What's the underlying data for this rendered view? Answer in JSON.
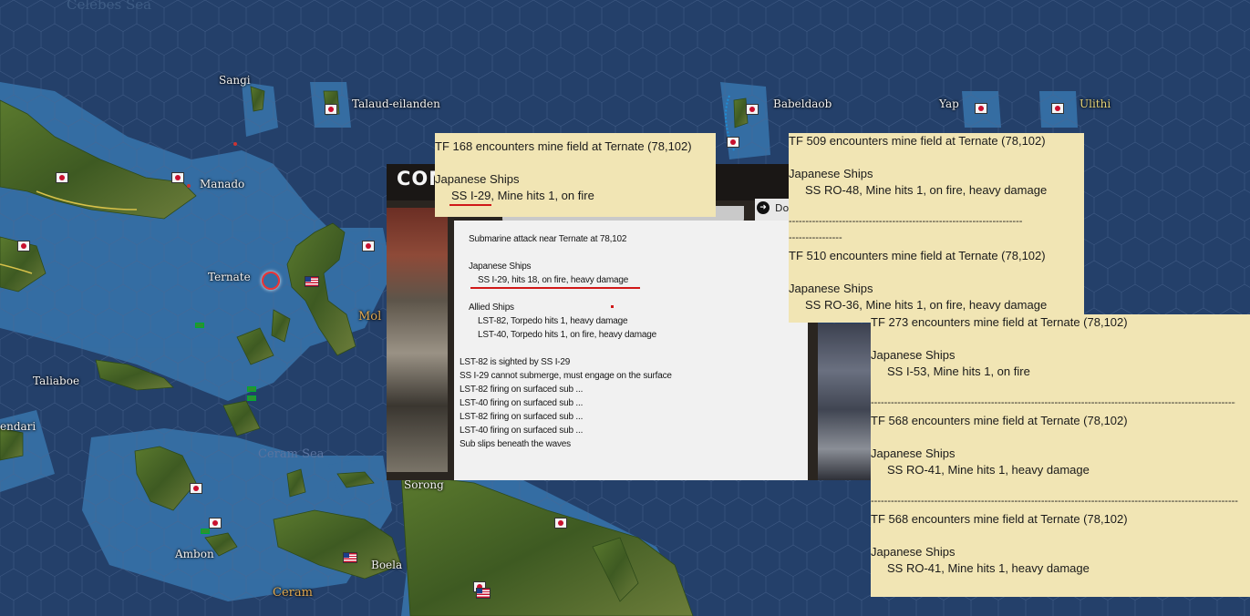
{
  "map": {
    "labels": {
      "celebes_sea": "Celebes Sea",
      "sangi": "Sangi",
      "talaud": "Talaud-eilanden",
      "babeldaob": "Babeldaob",
      "yap": "Yap",
      "ulithi": "Ulithi",
      "manado": "Manado",
      "ternate": "Ternate",
      "molucca": "Mol",
      "taliaboe": "Taliaboe",
      "kendari": "endari",
      "ceram_sea": "Ceram Sea",
      "sorong": "Sorong",
      "ambon": "Ambon",
      "boela": "Boela",
      "ceram": "Ceram"
    },
    "colors": {
      "deep_sea": "#24406a",
      "shallow_sea": "#3a74a8",
      "land": "#4a6a2a"
    }
  },
  "combat_window": {
    "title": "COM",
    "done_label": "Don",
    "report": {
      "header": "Submarine attack near Ternate at 78,102",
      "japanese_header": "Japanese Ships",
      "japanese_ship": "SS I-29, hits 18,  on fire,  heavy damage",
      "allied_header": "Allied Ships",
      "allied_ships": [
        "LST-82, Torpedo hits 1,  heavy damage",
        "LST-40, Torpedo hits 1,  on fire,  heavy damage"
      ],
      "events": [
        "LST-82 is sighted by SS I-29",
        "SS I-29 cannot submerge, must engage on the surface",
        "LST-82 firing on surfaced sub ...",
        "LST-40 firing on surfaced sub ...",
        "LST-82 firing on surfaced sub ...",
        "LST-40 firing on surfaced sub ...",
        "Sub slips beneath the waves"
      ]
    }
  },
  "notes": {
    "note1": {
      "title": "TF 168 encounters mine field at Ternate (78,102)",
      "header": "Japanese Ships",
      "ship": "SS I-29, Mine hits 1,  on fire"
    },
    "note2": {
      "entries": [
        {
          "title": "TF 509 encounters mine field at Ternate (78,102)",
          "header": "Japanese Ships",
          "ship": "SS RO-48, Mine hits 1,  on fire,  heavy damage"
        },
        {
          "title": "TF 510 encounters mine field at Ternate (78,102)",
          "header": "Japanese Ships",
          "ship": "SS RO-36, Mine hits 1,  on fire,  heavy damage"
        }
      ],
      "separator_a": "----------------------------------------------------------------------",
      "separator_b": "----------------"
    },
    "note3": {
      "entries": [
        {
          "title": "TF 273 encounters mine field at Ternate (78,102)",
          "header": "Japanese Ships",
          "ship": "SS I-53, Mine hits 1,  on fire"
        },
        {
          "title": "TF 568 encounters mine field at Ternate (78,102)",
          "header": "Japanese Ships",
          "ship": "SS RO-41, Mine hits 1,  heavy damage"
        },
        {
          "title": "TF 568 encounters mine field at Ternate (78,102)",
          "header": "Japanese Ships",
          "ship": "SS RO-41, Mine hits 1,  heavy damage"
        }
      ],
      "separator": "--------------------------------------------------------------------------------------------------------------"
    }
  }
}
